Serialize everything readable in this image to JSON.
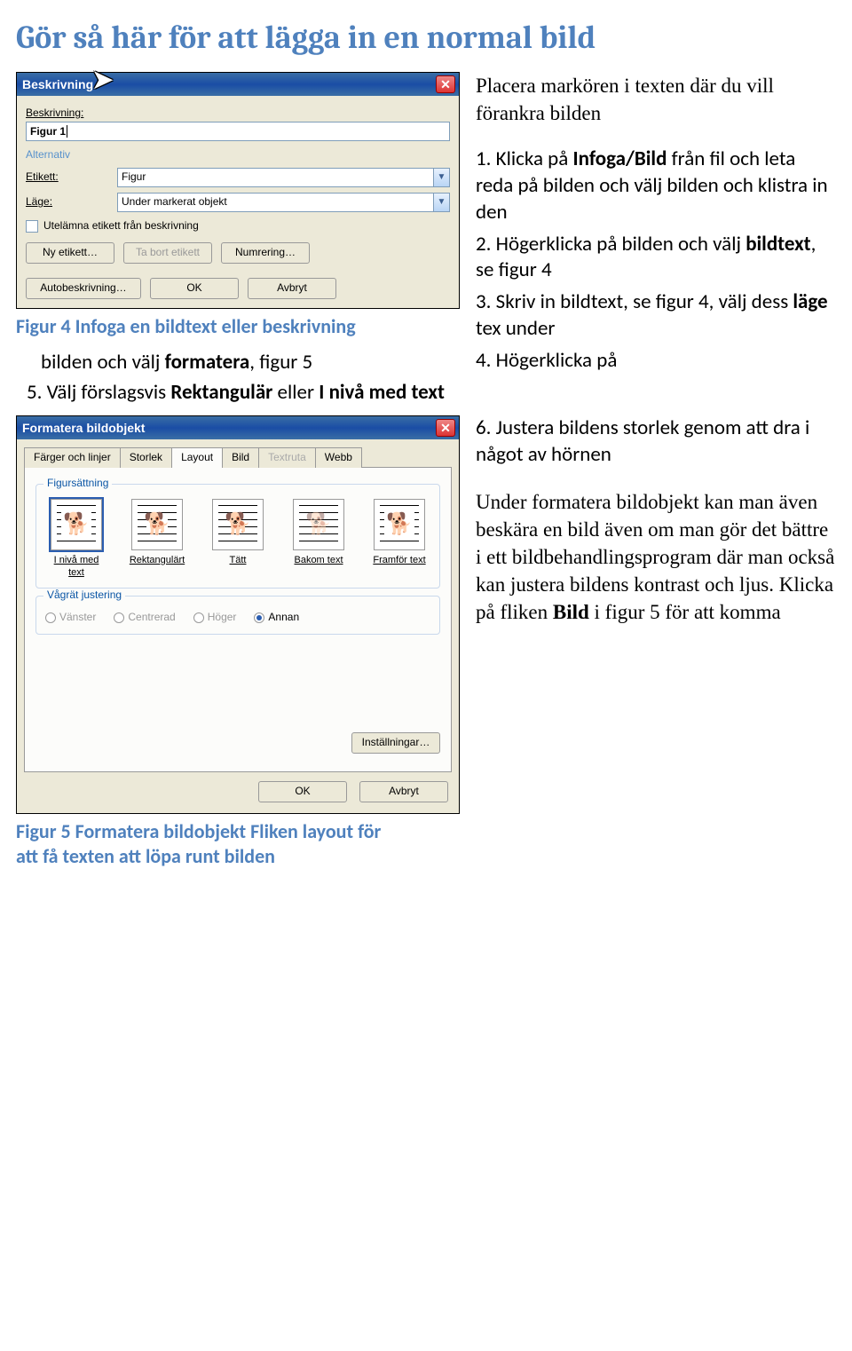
{
  "heading": "Gör så här för att lägga in en normal bild",
  "intro": "Placera markören i texten där du vill förankra bilden",
  "dialog1": {
    "title": "Beskrivning",
    "label_beskrivning": "Beskrivning:",
    "value_beskrivning": "Figur 1",
    "group_alt": "Alternativ",
    "label_etikett": "Etikett:",
    "value_etikett": "Figur",
    "label_lage": "Läge:",
    "value_lage": "Under markerat objekt",
    "chk_label": "Utelämna etikett från beskrivning",
    "btn_new": "Ny etikett…",
    "btn_del": "Ta bort etikett",
    "btn_num": "Numrering…",
    "btn_auto": "Autobeskrivning…",
    "btn_ok": "OK",
    "btn_cancel": "Avbryt"
  },
  "caption1": "Figur 4  Infoga en bildtext eller beskrivning",
  "steps": {
    "s1a": "1. Klicka på ",
    "s1b": "Infoga/Bild",
    "s1c": " från fil och leta reda på bilden och välj bilden och klistra in den",
    "s2a": "2. Högerklicka på bilden och välj ",
    "s2b": "bildtext",
    "s2c": ", se figur 4",
    "s3a": "3. Skriv in bildtext, se figur 4, välj dess ",
    "s3b": "läge",
    "s3c": " tex under",
    "s4a": "4. Högerklicka på",
    "s4b": "bilden och välj ",
    "s4c": "formatera",
    "s4d": ", figur 5",
    "s5a": "5. Välj förslagsvis  ",
    "s5b": "Rektangulär",
    "s5c": " eller ",
    "s5d": "I nivå med text",
    "s6": "6. Justera bildens storlek genom att dra i något av hörnen"
  },
  "dialog2": {
    "title": "Formatera bildobjekt",
    "tabs": {
      "colors": "Färger och linjer",
      "size": "Storlek",
      "layout": "Layout",
      "image": "Bild",
      "textbox": "Textruta",
      "web": "Webb"
    },
    "grp_wrap": "Figursättning",
    "wrap": {
      "inline": "I nivå med text",
      "square": "Rektangulärt",
      "tight": "Tätt",
      "behind": "Bakom text",
      "front": "Framför text"
    },
    "grp_align": "Vågrät justering",
    "align": {
      "left": "Vänster",
      "center": "Centrerad",
      "right": "Höger",
      "other": "Annan"
    },
    "btn_settings": "Inställningar…",
    "btn_ok": "OK",
    "btn_cancel": "Avbryt"
  },
  "caption2": "Figur  5 Formatera bildobjekt Fliken layout för att få texten att löpa runt bilden",
  "closing": {
    "p1a": "Under formatera bildobjekt kan man även beskära en bild även om man gör det bättre i ett bildbehandlingsprogram där man också kan justera bildens kontrast och ljus. Klicka på fliken ",
    "p1b": "Bild",
    "p1c": " i figur 5 för att komma"
  }
}
